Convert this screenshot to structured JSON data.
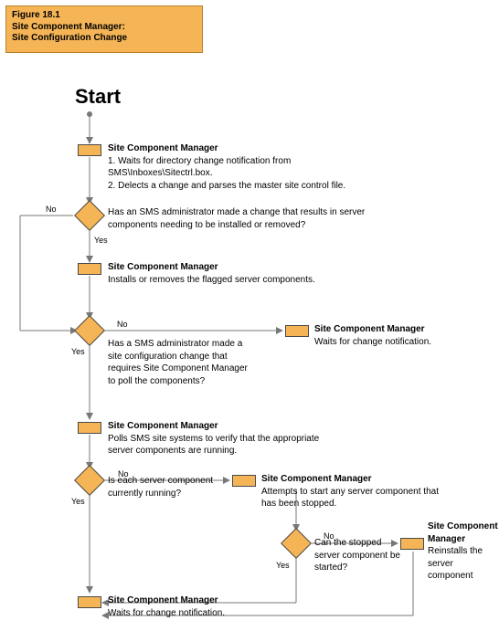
{
  "title": {
    "fig": "Figure 18.1",
    "line1": "Site Component Manager:",
    "line2": "Site Configuration Change"
  },
  "start_label": "Start",
  "labels": {
    "no": "No",
    "yes": "Yes"
  },
  "n1": {
    "heading": "Site Component Manager",
    "body": "1. Waits for directory change notification from SMS\\Inboxes\\Sitectrl.box.\n2. Delects a change and parses the master site control file."
  },
  "d1": {
    "text": "Has an SMS administrator made a change that results in server components needing to be installed or removed?"
  },
  "n2": {
    "heading": "Site Component Manager",
    "body": "Installs or removes the flagged server components."
  },
  "d2": {
    "text": "Has a SMS administrator made a site configuration change that requires Site Component Manager to poll the components?"
  },
  "n2b": {
    "heading": "Site Component Manager",
    "body": "Waits for change notification."
  },
  "n3": {
    "heading": "Site Component Manager",
    "body": "Polls SMS site systems to verify that the appropriate server components are running."
  },
  "d3": {
    "text": "Is each server component currently running?"
  },
  "n4": {
    "heading": "Site Component Manager",
    "body": "Attempts to start any server component that has been stopped."
  },
  "d4": {
    "text": "Can the stopped server component be started?"
  },
  "n5": {
    "heading": "Site Component Manager",
    "body": "Reinstalls the server component"
  },
  "n6": {
    "heading": "Site Component Manager",
    "body": "Waits for change notification."
  },
  "chart_data": {
    "type": "flowchart",
    "title": "Site Component Manager: Site Configuration Change",
    "nodes": [
      {
        "id": "start",
        "type": "start",
        "label": "Start"
      },
      {
        "id": "n1",
        "type": "process",
        "label": "Site Component Manager — Waits for directory change notification from SMS\\Inboxes\\Sitectrl.box; detects a change and parses the master site control file."
      },
      {
        "id": "d1",
        "type": "decision",
        "label": "Has an SMS administrator made a change that results in server components needing to be installed or removed?"
      },
      {
        "id": "n2",
        "type": "process",
        "label": "Site Component Manager — Installs or removes the flagged server components."
      },
      {
        "id": "d2",
        "type": "decision",
        "label": "Has a SMS administrator made a site configuration change that requires Site Component Manager to poll the components?"
      },
      {
        "id": "n2b",
        "type": "process",
        "label": "Site Component Manager — Waits for change notification."
      },
      {
        "id": "n3",
        "type": "process",
        "label": "Site Component Manager — Polls SMS site systems to verify that the appropriate server components are running."
      },
      {
        "id": "d3",
        "type": "decision",
        "label": "Is each server component currently running?"
      },
      {
        "id": "n4",
        "type": "process",
        "label": "Site Component Manager — Attempts to start any server component that has been stopped."
      },
      {
        "id": "d4",
        "type": "decision",
        "label": "Can the stopped server component be started?"
      },
      {
        "id": "n5",
        "type": "process",
        "label": "Site Component Manager — Reinstalls the server component."
      },
      {
        "id": "n6",
        "type": "process",
        "label": "Site Component Manager — Waits for change notification."
      }
    ],
    "edges": [
      {
        "from": "start",
        "to": "n1"
      },
      {
        "from": "n1",
        "to": "d1"
      },
      {
        "from": "d1",
        "to": "n2",
        "label": "Yes"
      },
      {
        "from": "d1",
        "to": "d2",
        "label": "No"
      },
      {
        "from": "n2",
        "to": "d2"
      },
      {
        "from": "d2",
        "to": "n3",
        "label": "Yes"
      },
      {
        "from": "d2",
        "to": "n2b",
        "label": "No"
      },
      {
        "from": "n3",
        "to": "d3"
      },
      {
        "from": "d3",
        "to": "n6",
        "label": "Yes"
      },
      {
        "from": "d3",
        "to": "n4",
        "label": "No"
      },
      {
        "from": "n4",
        "to": "d4"
      },
      {
        "from": "d4",
        "to": "n6",
        "label": "Yes"
      },
      {
        "from": "d4",
        "to": "n5",
        "label": "No"
      },
      {
        "from": "n5",
        "to": "n6"
      }
    ]
  }
}
